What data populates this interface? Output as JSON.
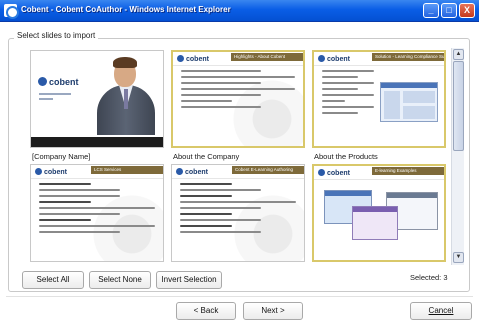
{
  "window": {
    "title": "Cobent - Cobent CoAuthor - Windows Internet Explorer",
    "controls": [
      "_",
      "□",
      "X"
    ]
  },
  "group": {
    "legend": "Select slides to import"
  },
  "slides": [
    {
      "caption": "[Company Name]",
      "selected": false,
      "band": "",
      "type": "title",
      "title_text": "cobent",
      "sub": "Cobent Limited 2006"
    },
    {
      "caption": "About the Company",
      "selected": true,
      "band": "Highlights - About Cobent",
      "type": "bullets",
      "logo": "cobent"
    },
    {
      "caption": "About the Products",
      "selected": true,
      "band": "Solution - Learning Compliance Suite (LCS)",
      "type": "screenshot",
      "logo": "cobent"
    },
    {
      "caption": "",
      "selected": false,
      "band": "LCS Services",
      "type": "bullets",
      "logo": "cobent"
    },
    {
      "caption": "",
      "selected": false,
      "band": "Cobent E-Learning Authoring",
      "type": "bullets",
      "logo": "cobent"
    },
    {
      "caption": "",
      "selected": true,
      "band": "E-learning Examples",
      "type": "screens",
      "logo": "cobent"
    }
  ],
  "buttons": {
    "select_all": "Select All",
    "select_none": "Select None",
    "invert_selection": "Invert Selection"
  },
  "status": {
    "selected_label": "Selected: 3"
  },
  "nav": {
    "back": "< Back",
    "next": "Next >",
    "cancel": "Cancel"
  }
}
